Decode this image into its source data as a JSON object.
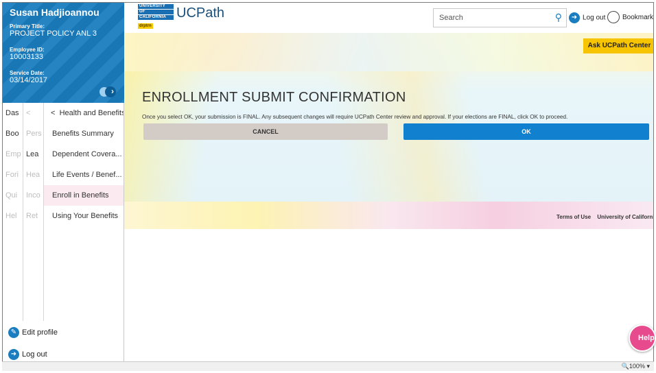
{
  "profile": {
    "name": "Susan Hadjioannou",
    "primary_title_label": "Primary Title:",
    "primary_title": "PROJECT POLICY ANL 3",
    "employee_id_label": "Employee ID:",
    "employee_id": "10003133",
    "service_date_label": "Service Date:",
    "service_date": "03/14/2017"
  },
  "nav": {
    "col1": [
      "Das",
      "Boo",
      "Emp",
      "Fori",
      "Qui",
      "Hel"
    ],
    "col2_back": "<",
    "col2": [
      "Pers",
      "Lea",
      "Hea",
      "Inco",
      "Ret"
    ],
    "col3_header": "Health and Benefits",
    "col3_back": "<",
    "col3": [
      "Benefits Summary",
      "Dependent Covera...",
      "Life Events / Benef...",
      "Enroll in Benefits",
      "Using Your Benefits"
    ]
  },
  "sidefoot": {
    "edit_profile": "Edit profile",
    "log_out": "Log out"
  },
  "header": {
    "logo_line1": "UNIVERSITY",
    "logo_line2": "OF",
    "logo_line3": "CALIFORNIA",
    "logo_tag": "drptrn",
    "brand": "UCPath",
    "search_placeholder": "Search",
    "logout": "Log out",
    "bookmark": "Bookmark"
  },
  "main": {
    "ask_button": "Ask UCPath Center",
    "title": "ENROLLMENT SUBMIT CONFIRMATION",
    "message": "Once you select OK, your submission is FINAL. Any subsequent changes will require UCPath Center review and approval. If your elections are FINAL, click OK to proceed.",
    "cancel": "CANCEL",
    "ok": "OK",
    "footer_links": [
      "Terms of Use",
      "University of California"
    ]
  },
  "help_button": "Help",
  "status": {
    "zoom": "100%"
  },
  "colors": {
    "primary_blue": "#1a7dbf",
    "ok_blue": "#1180cf",
    "accent_yellow": "#f6c400",
    "help_pink": "#e84a8e",
    "cancel_gray": "#d2cbc6"
  }
}
